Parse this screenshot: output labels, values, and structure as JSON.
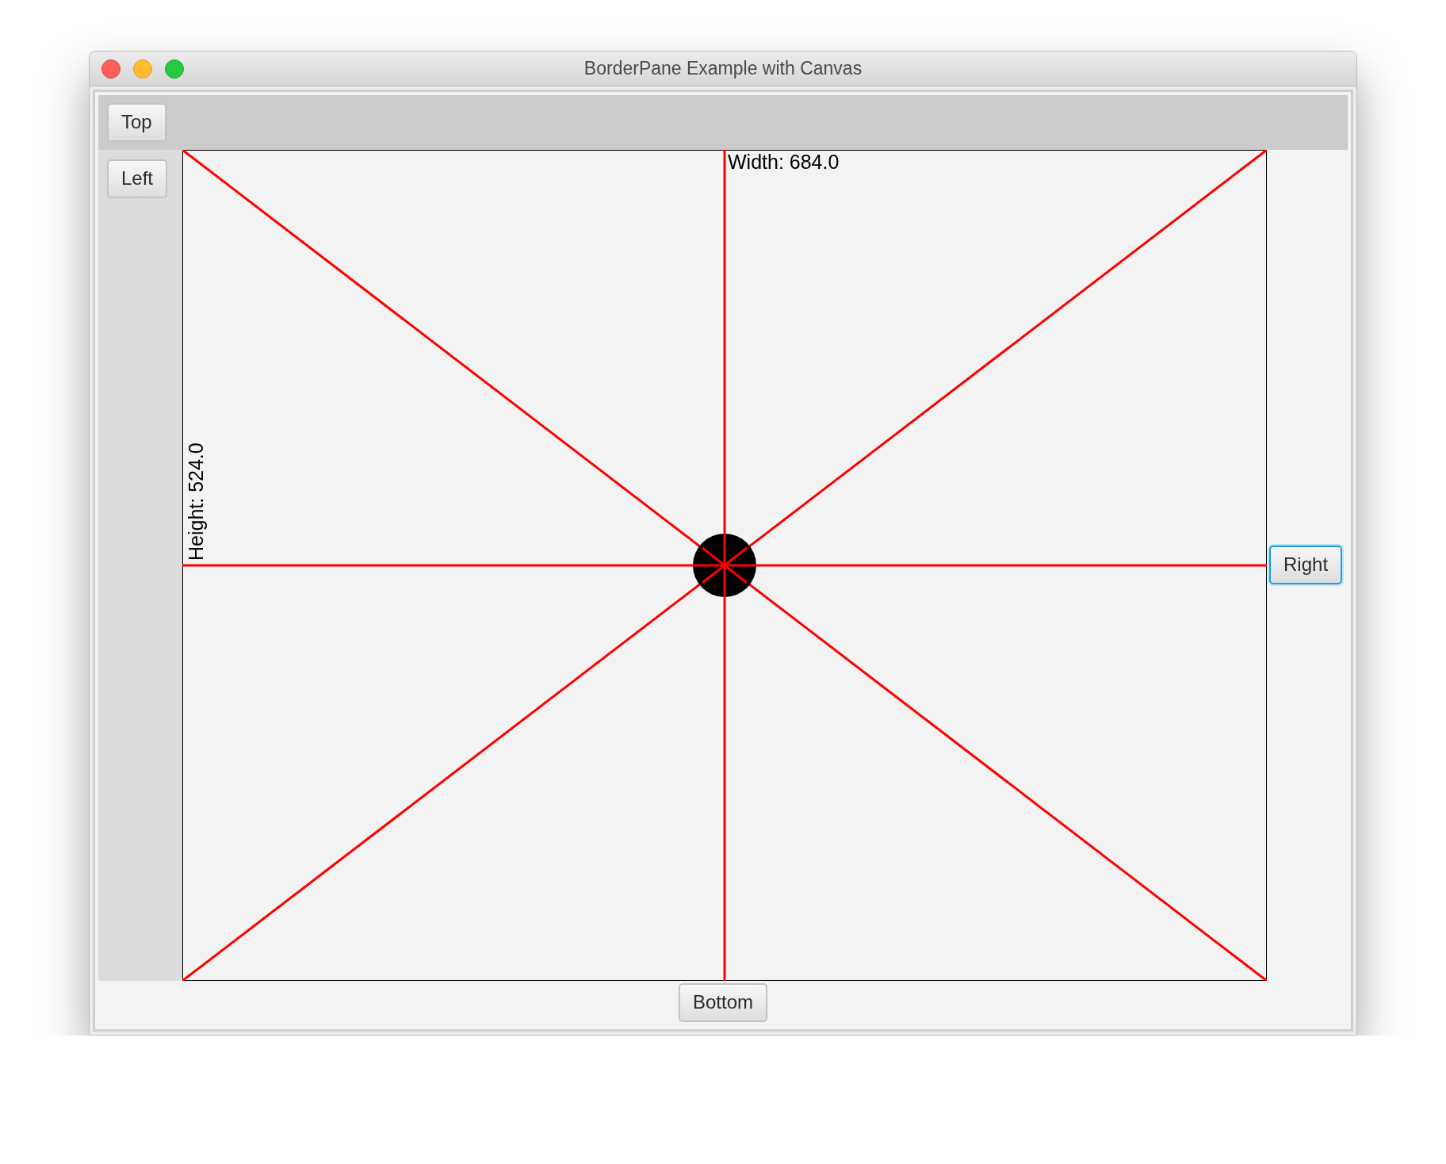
{
  "window": {
    "title": "BorderPane Example with Canvas"
  },
  "regions": {
    "top": {
      "label": "Top",
      "focused": false
    },
    "left": {
      "label": "Left",
      "focused": false
    },
    "right": {
      "label": "Right",
      "focused": true
    },
    "bottom": {
      "label": "Bottom",
      "focused": false
    }
  },
  "canvas": {
    "width_label": "Width: 684.0",
    "height_label": "Height: 524.0"
  }
}
